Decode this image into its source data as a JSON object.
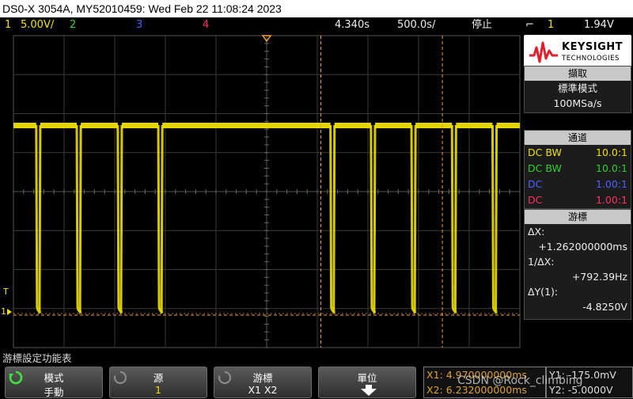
{
  "title": "DS0-X 3054A, MY52010459: Wed Feb 22 11:08:24 2023",
  "status": {
    "ch1_num": "1",
    "ch1_scale": "5.00V/",
    "ch2_num": "2",
    "ch3_num": "3",
    "ch4_num": "4",
    "delay": "4.340s",
    "timebase": "500.0s/",
    "run_state": "停止",
    "trig_icon": "⌐",
    "trig_src": "1",
    "trig_level": "1.94V"
  },
  "colors": {
    "ch1": "#f0e000",
    "ch2": "#30d030",
    "ch3": "#5060ff",
    "ch4": "#ff3060",
    "cursor": "#f0a040",
    "grid": "#3a3a3a"
  },
  "brand": {
    "name": "KEYSIGHT",
    "sub": "TECHNOLOGIES"
  },
  "acquire": {
    "header": "擷取",
    "mode": "標準模式",
    "rate": "100MSa/s"
  },
  "channels": {
    "header": "通道",
    "rows": [
      {
        "coupling": "DC BW",
        "probe": "10.0:1"
      },
      {
        "coupling": "DC BW",
        "probe": "10.0:1"
      },
      {
        "coupling": "DC",
        "probe": "1.00:1"
      },
      {
        "coupling": "DC",
        "probe": "1.00:1"
      }
    ]
  },
  "cursors": {
    "header": "游標",
    "dx_label": "ΔX:",
    "dx_value": "+1.262000000ms",
    "inv_label": "1/ΔX:",
    "inv_value": "+792.39Hz",
    "dy_label": "ΔY(1):",
    "dy_value": "-4.8250V"
  },
  "markers": {
    "trig": "T",
    "ground": "1"
  },
  "menu_title": "游標設定功能表",
  "softkeys": {
    "mode_label": "模式",
    "mode_value": "手動",
    "source_label": "源",
    "source_value": "1",
    "cursors_label": "游標",
    "cursors_value": "X1 X2",
    "units_label": "單位",
    "units_icon": "down-arrow-icon"
  },
  "cursor_readout": {
    "x1": "X1: 4.970000000ms",
    "x2": "X2: 6.232000000ms",
    "y1": "Y1: -175.0mV",
    "y2": "Y2: -5.0000V"
  },
  "watermark": "CSDN @Rock_climbing",
  "waveform": {
    "segments": [
      {
        "start": 0.0,
        "end": 0.045
      },
      {
        "start": 0.053,
        "end": 0.125
      },
      {
        "start": 0.133,
        "end": 0.206
      },
      {
        "start": 0.214,
        "end": 0.286
      },
      {
        "start": 0.294,
        "end": 0.626
      },
      {
        "start": 0.634,
        "end": 0.706
      },
      {
        "start": 0.714,
        "end": 0.786
      },
      {
        "start": 0.794,
        "end": 0.866
      },
      {
        "start": 0.874,
        "end": 0.946
      },
      {
        "start": 0.954,
        "end": 1.0
      }
    ],
    "cursor_x1_frac": 0.607,
    "cursor_x2_frac": 0.847
  }
}
